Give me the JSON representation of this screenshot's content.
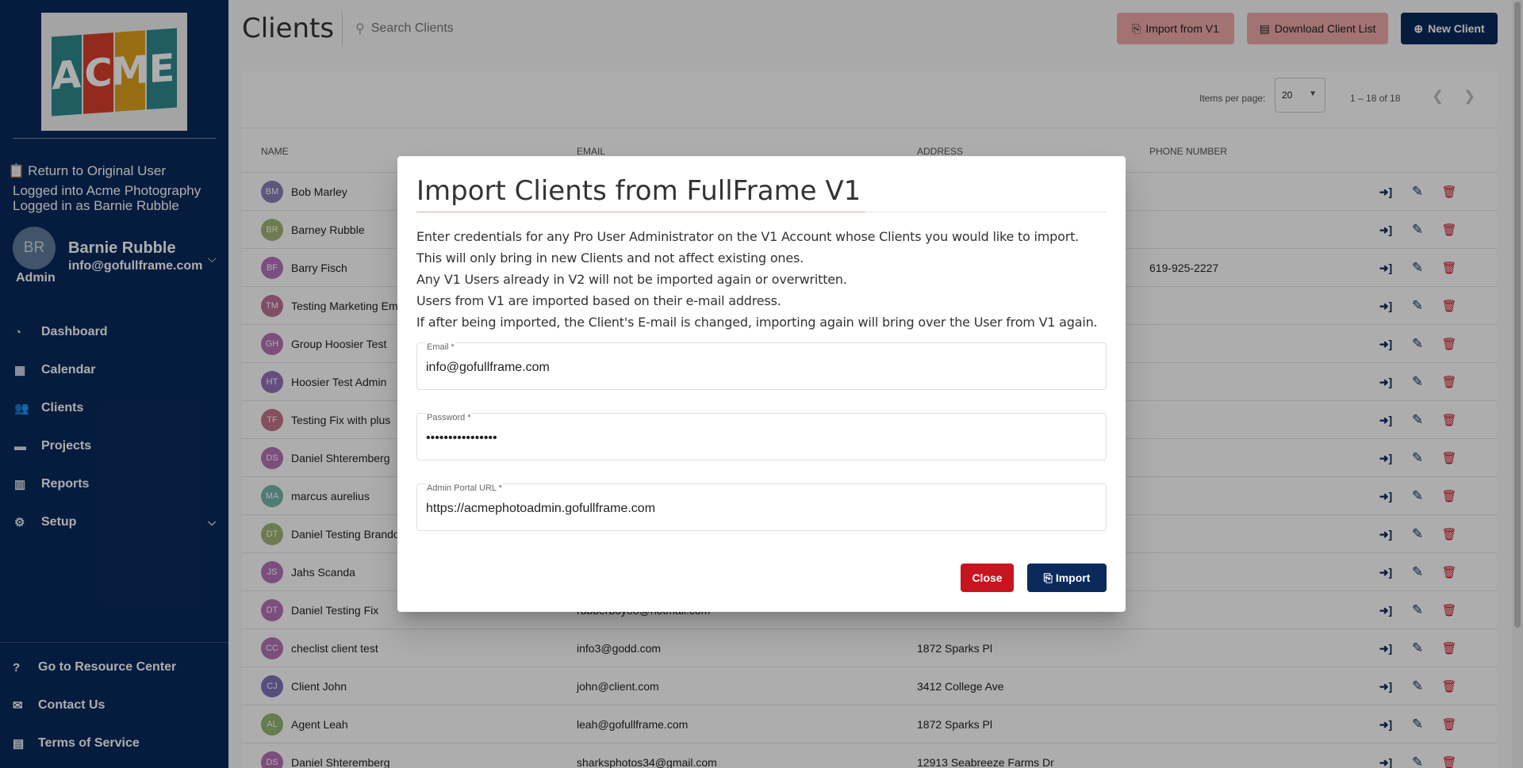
{
  "sidebar": {
    "logo_letters": [
      "A",
      "C",
      "M",
      "E"
    ],
    "logo_colors": [
      "#2e8a8f",
      "#d9402c",
      "#e0a21e",
      "#2e8a8f"
    ],
    "return_label": "Return to Original User",
    "logged_into": "Logged into Acme Photography",
    "logged_as": "Logged in as Barnie Rubble",
    "user": {
      "initials": "BR",
      "name": "Barnie Rubble",
      "email": "info@gofullframe.com",
      "role": "Admin"
    },
    "nav": [
      {
        "label": "Dashboard",
        "icon": "dashboard-icon"
      },
      {
        "label": "Calendar",
        "icon": "calendar-icon"
      },
      {
        "label": "Clients",
        "icon": "users-icon"
      },
      {
        "label": "Projects",
        "icon": "folder-icon"
      },
      {
        "label": "Reports",
        "icon": "chart-icon"
      },
      {
        "label": "Setup",
        "icon": "gear-icon"
      }
    ],
    "bottom": [
      {
        "label": "Go to Resource Center",
        "icon": "help-icon"
      },
      {
        "label": "Contact Us",
        "icon": "mail-icon"
      },
      {
        "label": "Terms of Service",
        "icon": "document-icon"
      }
    ]
  },
  "header": {
    "title": "Clients",
    "search_placeholder": "Search Clients",
    "import_btn": "Import from V1",
    "download_btn": "Download Client List",
    "new_btn": "New Client"
  },
  "paginator": {
    "items_per_page_label": "Items per page:",
    "items_per_page": "20",
    "range": "1 – 18 of 18"
  },
  "table": {
    "columns": [
      "NAME",
      "EMAIL",
      "ADDRESS",
      "PHONE NUMBER"
    ],
    "rows": [
      {
        "initials": "BM",
        "name": "Bob Marley",
        "email": "",
        "address": "",
        "phone": "",
        "color": "#5c4a9c"
      },
      {
        "initials": "BR",
        "name": "Barney Rubble",
        "email": "",
        "address": "",
        "phone": "",
        "color": "#7a9a3a"
      },
      {
        "initials": "BF",
        "name": "Barry Fisch",
        "email": "",
        "address": "",
        "phone": "619-925-2227",
        "color": "#9a3aa0"
      },
      {
        "initials": "TM",
        "name": "Testing Marketing Em",
        "email": "",
        "address": "",
        "phone": "",
        "color": "#a03a6a"
      },
      {
        "initials": "GH",
        "name": "Group Hoosier Test",
        "email": "",
        "address": "",
        "phone": "",
        "color": "#9a3a9a"
      },
      {
        "initials": "HT",
        "name": "Hoosier Test Admin",
        "email": "",
        "address": "",
        "phone": "",
        "color": "#6a3aa0"
      },
      {
        "initials": "TF",
        "name": "Testing Fix with plus",
        "email": "",
        "address": "",
        "phone": "",
        "color": "#b03a5a"
      },
      {
        "initials": "DS",
        "name": "Daniel Shteremberg",
        "email": "",
        "address": "",
        "phone": "",
        "color": "#9a3a9a"
      },
      {
        "initials": "MA",
        "name": "marcus aurelius",
        "email": "",
        "address": "",
        "phone": "",
        "color": "#3a9a8a"
      },
      {
        "initials": "DT",
        "name": "Daniel Testing Brando",
        "email": "",
        "address": "",
        "phone": "",
        "color": "#7a9a3a"
      },
      {
        "initials": "JS",
        "name": "Jahs Scanda",
        "email": "",
        "address": "",
        "phone": "",
        "color": "#9a3aa0"
      },
      {
        "initials": "DT",
        "name": "Daniel Testing Fix",
        "email": "rubberboy88@hotmail.com",
        "address": "",
        "phone": "",
        "color": "#9a3a9a"
      },
      {
        "initials": "CC",
        "name": "checlist client test",
        "email": "info3@godd.com",
        "address": "1872 Sparks Pl",
        "phone": "",
        "color": "#9a3a9a"
      },
      {
        "initials": "CJ",
        "name": "Client John",
        "email": "john@client.com",
        "address": "3412 College Ave",
        "phone": "",
        "color": "#4a3aa0"
      },
      {
        "initials": "AL",
        "name": "Agent Leah",
        "email": "leah@gofullframe.com",
        "address": "1872 Sparks Pl",
        "phone": "",
        "color": "#6a9a3a"
      },
      {
        "initials": "DS",
        "name": "Daniel Shteremberg",
        "email": "sharksphotos34@gmail.com",
        "address": "12913 Seabreeze Farms Dr",
        "phone": "",
        "color": "#9a3a9a"
      }
    ]
  },
  "dialog": {
    "title": "Import Clients from FullFrame V1",
    "lines": [
      "Enter credentials for any Pro User Administrator on the V1 Account whose Clients you would like to import.",
      "This will only bring in new Clients and not affect existing ones.",
      "Any V1 Users already in V2 will not be imported again or overwritten.",
      "Users from V1 are imported based on their e-mail address.",
      "If after being imported, the Client's E-mail is changed, importing again will bring over the User from V1 again."
    ],
    "email_label": "Email *",
    "email_value": "info@gofullframe.com",
    "password_label": "Password *",
    "password_value": "••••••••••••••••",
    "url_label": "Admin Portal URL *",
    "url_value": "https://acmephotoadmin.gofullframe.com",
    "close_btn": "Close",
    "import_btn": "Import"
  },
  "colors": {
    "navy": "#0a2a5c",
    "danger": "#c8141e",
    "pink": "#f1aaaa"
  }
}
